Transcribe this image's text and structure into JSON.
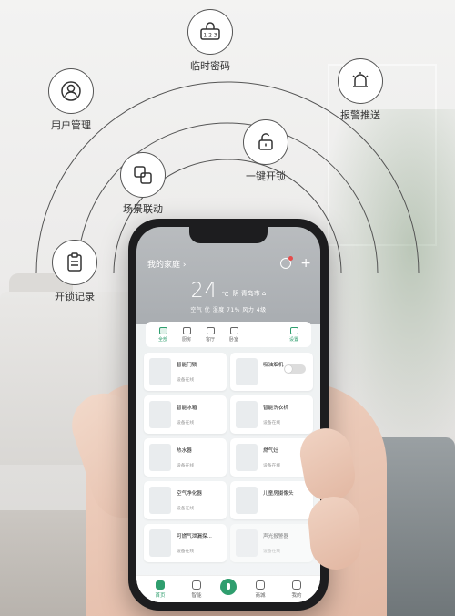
{
  "features": [
    {
      "id": "temp-password",
      "icon": "keypad-icon",
      "label": "临时密码",
      "code": "1 2 3"
    },
    {
      "id": "alarm-push",
      "icon": "alarm-light-icon",
      "label": "报警推送"
    },
    {
      "id": "user-management",
      "icon": "user-icon",
      "label": "用户管理"
    },
    {
      "id": "one-key-unlock",
      "icon": "unlock-icon",
      "label": "一键开锁"
    },
    {
      "id": "scene-linkage",
      "icon": "scene-link-icon",
      "label": "场景联动"
    },
    {
      "id": "unlock-record",
      "icon": "clipboard-icon",
      "label": "开锁记录"
    }
  ],
  "app": {
    "home_name": "我的家庭 ›",
    "weather": {
      "temp": "24",
      "unit": "℃",
      "desc": "阴 青岛市 ⌂",
      "detail": "空气 优 湿度 71% 风力 4级"
    },
    "rooms": [
      "全部",
      "厨房",
      "客厅",
      "卧室",
      "设置"
    ],
    "devices": [
      {
        "name": "智能门锁",
        "status": "设备在线",
        "toggle": false
      },
      {
        "name": "吸油烟机",
        "status": "",
        "toggle": true
      },
      {
        "name": "智能冰箱",
        "status": "设备在线",
        "toggle": false
      },
      {
        "name": "智能洗衣机",
        "status": "设备在线",
        "toggle": false
      },
      {
        "name": "热水器",
        "status": "设备在线",
        "toggle": false
      },
      {
        "name": "燃气灶",
        "status": "设备在线",
        "toggle": false
      },
      {
        "name": "空气净化器",
        "status": "设备在线",
        "toggle": false
      },
      {
        "name": "儿童房摄像头",
        "status": "",
        "toggle": false
      },
      {
        "name": "可燃气泄漏探...",
        "status": "设备在线",
        "toggle": false
      },
      {
        "name": "声光报警器",
        "status": "设备在线",
        "toggle": false
      }
    ],
    "tabs": [
      "首页",
      "智能",
      "",
      "商城",
      "我的"
    ]
  },
  "colors": {
    "accent": "#2f9e6e",
    "line": "#555555"
  }
}
